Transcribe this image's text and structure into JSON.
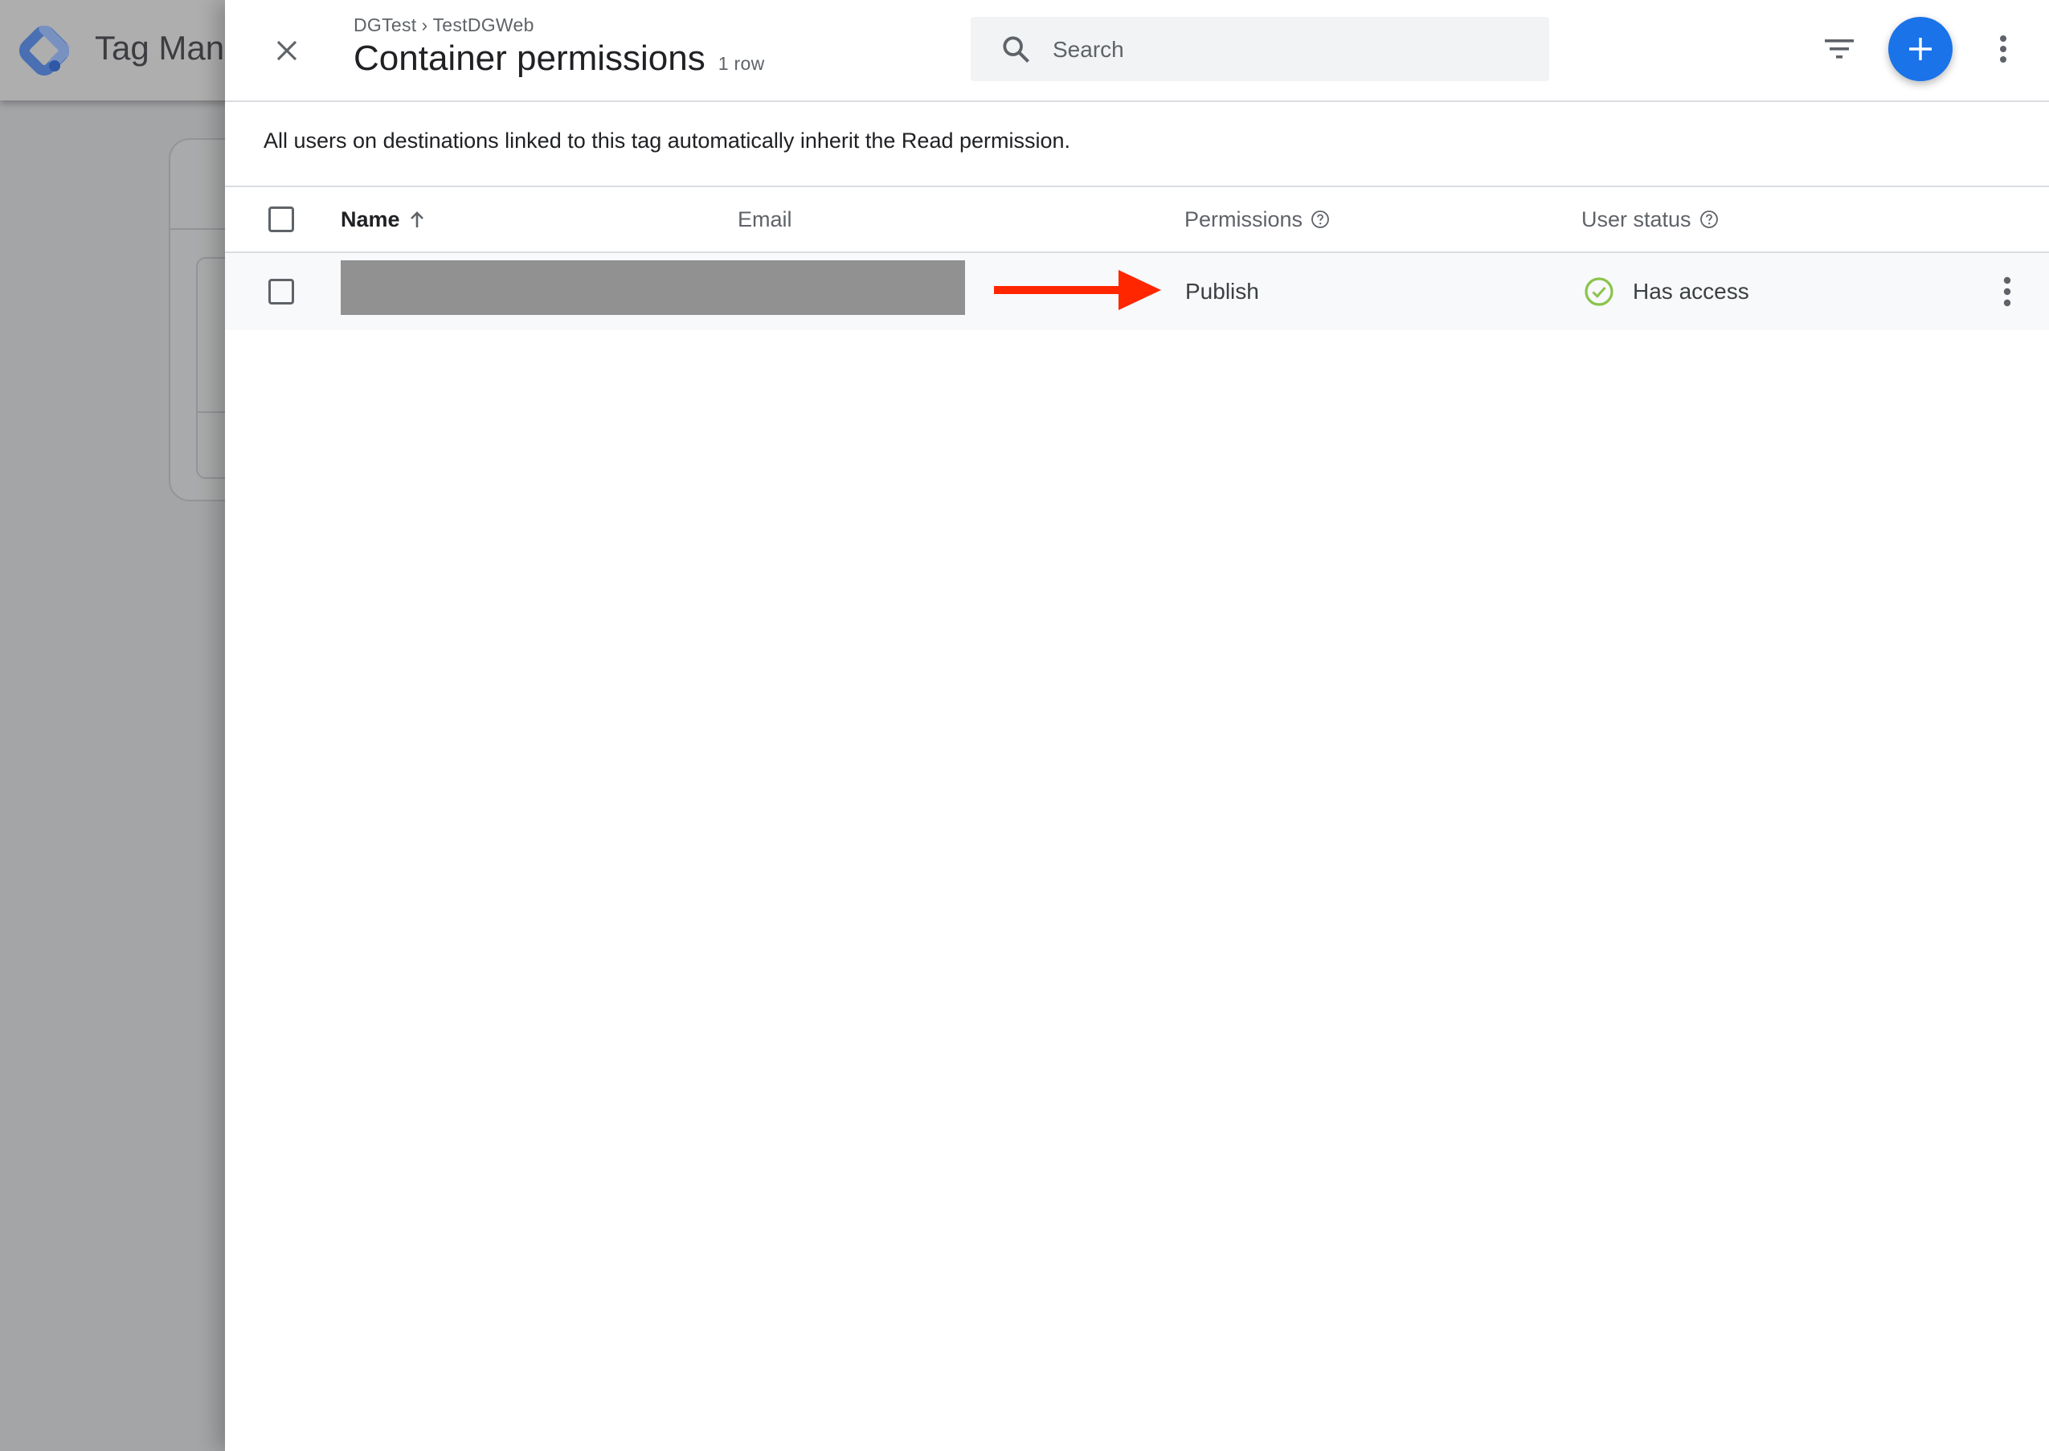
{
  "backdrop": {
    "app_title": "Tag Manager"
  },
  "panel": {
    "breadcrumb": {
      "account": "DGTest",
      "separator": "›",
      "container": "TestDGWeb"
    },
    "title": "Container permissions",
    "row_count": "1 row",
    "search": {
      "placeholder": "Search",
      "value": ""
    },
    "icons": {
      "close": "close-icon",
      "search": "search-icon",
      "filter": "filter-icon",
      "add": "add-icon",
      "more": "more-vert-icon"
    },
    "notice": "All users on destinations linked to this tag automatically inherit the Read permission."
  },
  "table": {
    "columns": [
      {
        "key": "name",
        "label": "Name",
        "sort": "ascending"
      },
      {
        "key": "email",
        "label": "Email"
      },
      {
        "key": "permissions",
        "label": "Permissions",
        "help": true
      },
      {
        "key": "user_status",
        "label": "User status",
        "help": true
      }
    ],
    "rows": [
      {
        "name": "[redacted]",
        "email": "[redacted]",
        "permissions": "Publish",
        "user_status": "Has access",
        "selected": false
      }
    ]
  },
  "annotation": {
    "type": "arrow",
    "points_to": "Publish",
    "color": "#ff2600"
  },
  "colors": {
    "accent": "#1a73e8",
    "status_ok": "#8bc34a",
    "row_bg": "#f8f9fa",
    "redaction": "#919191"
  }
}
